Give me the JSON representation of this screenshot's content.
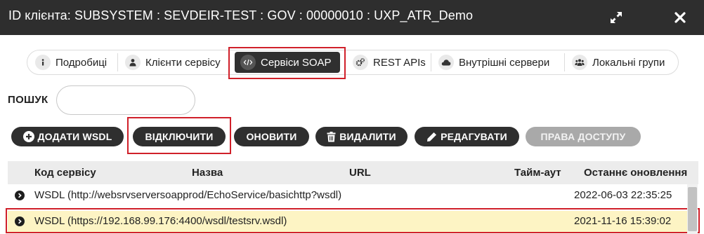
{
  "header": {
    "title": "ID клієнта: SUBSYSTEM : SEVDEIR-TEST : GOV : 00000010 : UXP_ATR_Demo"
  },
  "tabs": [
    {
      "label": "Подробиці",
      "icon": "info-icon",
      "active": false
    },
    {
      "label": "Клієнти сервісу",
      "icon": "user-icon",
      "active": false
    },
    {
      "label": "Сервіси SOAP",
      "icon": "code-icon",
      "active": true
    },
    {
      "label": "REST APIs",
      "icon": "gears-icon",
      "active": false
    },
    {
      "label": "Внутрішні сервери",
      "icon": "cloud-icon",
      "active": false
    },
    {
      "label": "Локальні групи",
      "icon": "group-icon",
      "active": false
    }
  ],
  "search": {
    "label": "ПОШУК",
    "value": "",
    "placeholder": ""
  },
  "toolbar": {
    "add_wsdl": "ДОДАТИ WSDL",
    "disable": "ВІДКЛЮЧИТИ",
    "refresh": "ОНОВИТИ",
    "delete": "ВИДАЛИТИ",
    "edit": "РЕДАГУВАТИ",
    "access_rights": "ПРАВА ДОСТУПУ"
  },
  "table": {
    "columns": [
      "Код сервісу",
      "Назва",
      "URL",
      "Тайм-аут",
      "Останнє оновлення"
    ],
    "rows": [
      {
        "code": "WSDL (http://websrvserversoapprod/EchoService/basichttp?wsdl)",
        "updated": "2022-06-03 22:35:25",
        "selected": false
      },
      {
        "code": "WSDL (https://192.168.99.176:4400/wsdl/testsrv.wsdl)",
        "updated": "2021-11-16 15:39:02",
        "selected": true
      }
    ]
  },
  "colors": {
    "titlebar_bg": "#2e2e2e",
    "button_dark": "#2f2f2f",
    "button_disabled": "#a9a9a9",
    "selected_row": "#fdf4c4",
    "highlight_red": "#d0202a"
  }
}
